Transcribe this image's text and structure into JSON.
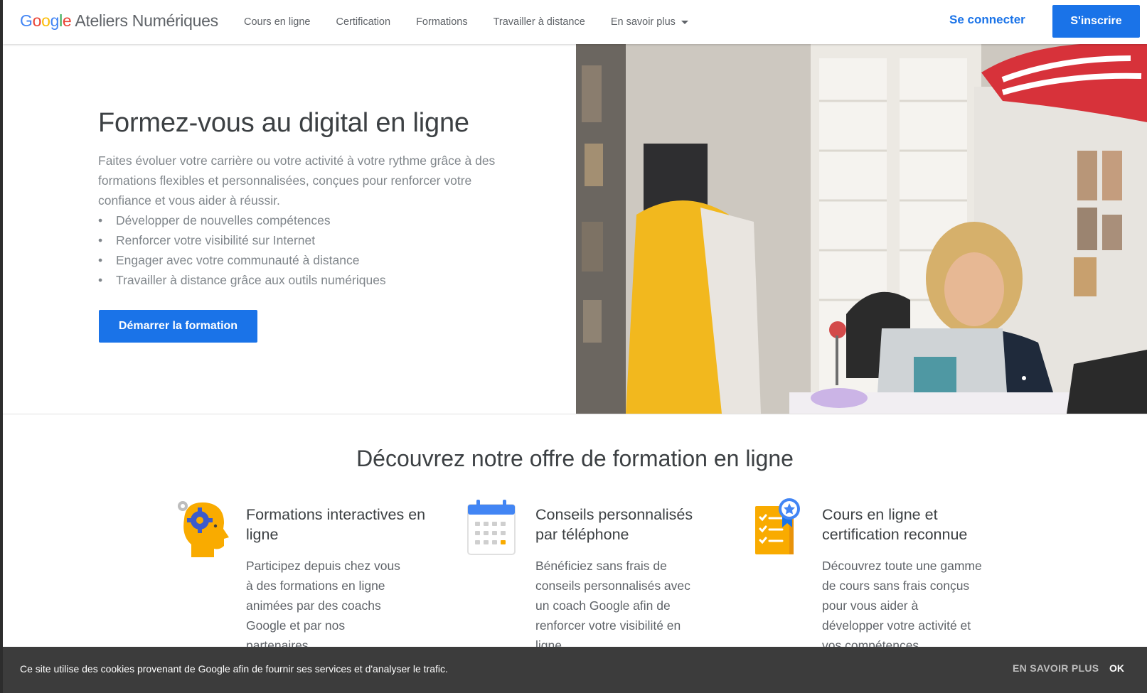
{
  "header": {
    "logo_google": [
      "G",
      "o",
      "o",
      "g",
      "l",
      "e"
    ],
    "logo_brand": "Ateliers Numériques",
    "nav": [
      {
        "label": "Cours en ligne"
      },
      {
        "label": "Certification"
      },
      {
        "label": "Formations"
      },
      {
        "label": "Travailler à distance"
      },
      {
        "label": "En savoir plus"
      }
    ],
    "login_label": "Se connecter",
    "signup_label": "S'inscrire"
  },
  "hero": {
    "title": "Formez-vous au digital en ligne",
    "description": "Faites évoluer votre carrière ou votre activité à votre rythme grâce à des formations flexibles et personnalisées, conçues pour renforcer votre confiance et vous aider à réussir.",
    "bullets": [
      "Développer de nouvelles compétences",
      "Renforcer votre visibilité sur Internet",
      "Engager avec votre communauté à distance",
      "Travailler à distance grâce aux outils numériques"
    ],
    "bullet_symbol": "•",
    "cta_label": "Démarrer la formation"
  },
  "offer": {
    "title": "Découvrez notre offre de formation en ligne",
    "features": [
      {
        "icon": "head-gear-icon",
        "title": "Formations interactives en ligne",
        "description": "Participez depuis chez vous à des formations en ligne animées par des coachs Google et par nos partenaires"
      },
      {
        "icon": "calendar-icon",
        "title": "Conseils personnalisés par téléphone",
        "description": "Bénéficiez sans frais de conseils personnalisés avec un coach Google afin de renforcer votre visibilité en ligne"
      },
      {
        "icon": "certificate-icon",
        "title": "Cours en ligne et certification reconnue",
        "description": "Découvrez toute une gamme de cours sans frais conçus pour vous aider à développer votre activité et vos compétences"
      }
    ]
  },
  "cookie": {
    "text": "Ce site utilise des cookies provenant de Google afin de fournir ses services et d'analyser le trafic.",
    "more_label": "EN SAVOIR PLUS",
    "ok_label": "OK"
  },
  "colors": {
    "accent": "#1a73e8",
    "google_blue": "#4285f4",
    "google_red": "#ea4335",
    "google_yellow": "#fbbc05",
    "google_green": "#34a853",
    "icon_orange": "#f9ab00"
  }
}
